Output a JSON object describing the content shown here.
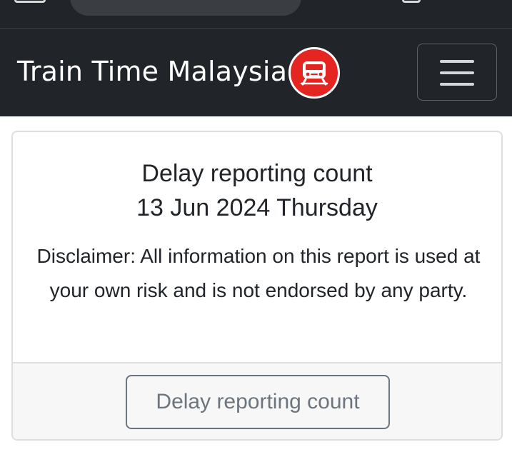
{
  "navbar": {
    "brand": "Train Time Malaysia",
    "logo_icon": "train-icon",
    "menu_icon": "hamburger-menu-icon",
    "background_color": "#212529",
    "logo_color": "#e52521"
  },
  "card": {
    "title": "Delay reporting count",
    "date": "13 Jun 2024 Thursday",
    "disclaimer": "Disclaimer: All information on this report is used at your own risk and is not endorsed by any party.",
    "button_label": "Delay reporting count"
  }
}
